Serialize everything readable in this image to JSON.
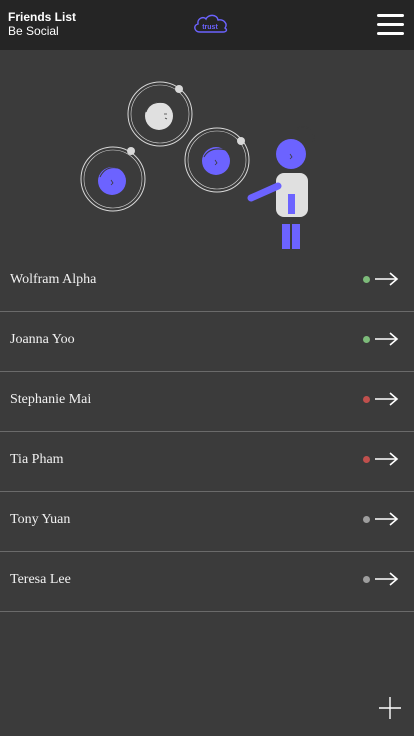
{
  "header": {
    "title": "Friends List",
    "subtitle": "Be Social",
    "logo_text": "trust",
    "menu_icon": "hamburger-menu-icon"
  },
  "colors": {
    "header_bg": "#252525",
    "page_bg": "#3b3b3b",
    "accent": "#6c63ff",
    "online": "#7dbb7a",
    "busy": "#c0504d",
    "offline": "#9e9e9e",
    "divider": "#6a6a6a"
  },
  "friends": [
    {
      "name": "Wolfram Alpha",
      "status": "online"
    },
    {
      "name": "Joanna Yoo",
      "status": "online"
    },
    {
      "name": "Stephanie Mai",
      "status": "busy"
    },
    {
      "name": "Tia Pham",
      "status": "busy"
    },
    {
      "name": "Tony Yuan",
      "status": "offline"
    },
    {
      "name": "Teresa Lee",
      "status": "offline"
    }
  ],
  "actions": {
    "row_icon": "arrow-right-icon",
    "add_icon": "plus-icon"
  }
}
